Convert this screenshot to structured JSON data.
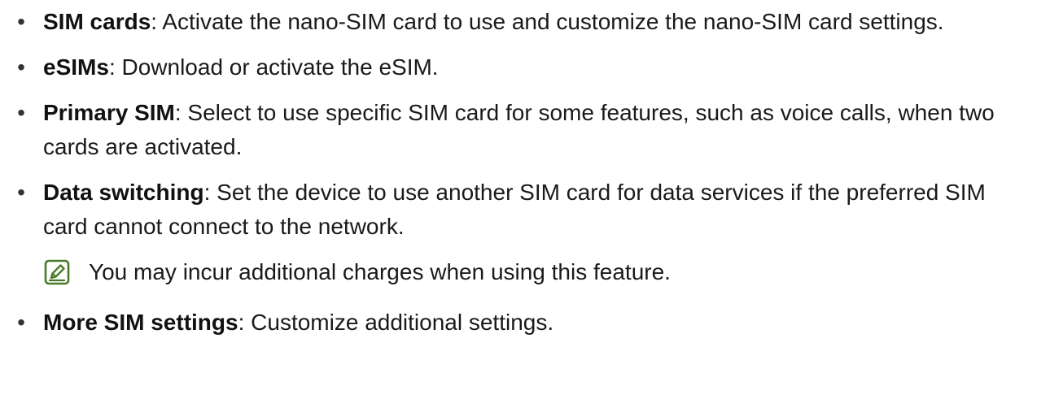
{
  "items": [
    {
      "term": "SIM cards",
      "sep": ":",
      "desc": " Activate the nano-SIM card to use and customize the nano-SIM card settings."
    },
    {
      "term": "eSIMs",
      "sep": ":",
      "desc": " Download or activate the eSIM."
    },
    {
      "term": "Primary SIM",
      "sep": ":",
      "desc": " Select to use specific SIM card for some features, such as voice calls, when two cards are activated."
    },
    {
      "term": "Data switching",
      "sep": ":",
      "desc": " Set the device to use another SIM card for data services if the preferred SIM card cannot connect to the network."
    },
    {
      "term": "More SIM settings",
      "sep": ":",
      "desc": " Customize additional settings."
    }
  ],
  "note": {
    "icon": "note-pencil-icon",
    "text": "You may incur additional charges when using this feature."
  },
  "colors": {
    "note_icon": "#4a7a2a",
    "text": "#1a1a1a"
  }
}
